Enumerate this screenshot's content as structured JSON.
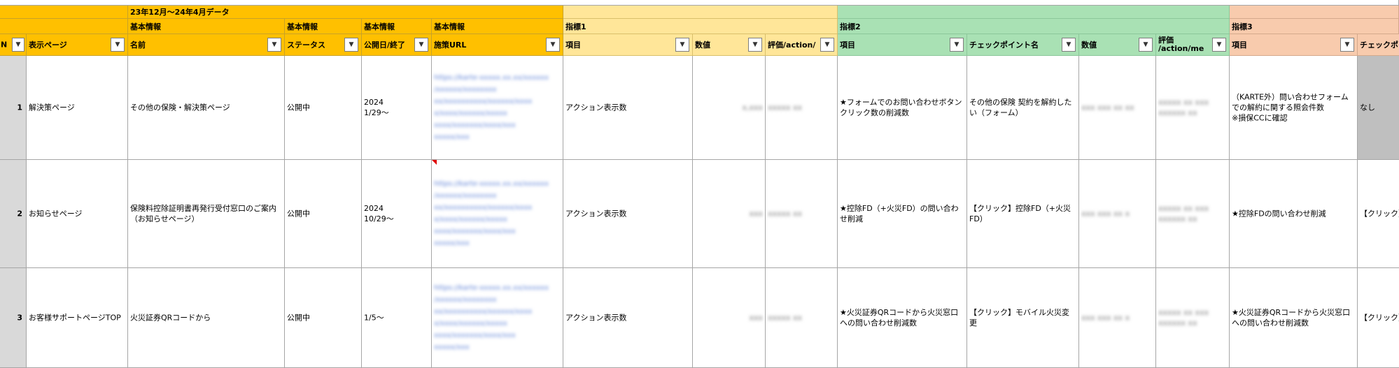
{
  "period_label": "23年12月～24年4月データ",
  "group_headers": {
    "basic": "基本情報",
    "indicator1": "指標1",
    "indicator2": "指標2",
    "indicator3": "指標3"
  },
  "columns": {
    "no": "N",
    "display_page": "表示ページ",
    "name": "名前",
    "status": "ステータス",
    "publish_date": "公開日/終了",
    "url": "施策URL",
    "i1_item": "項目",
    "i1_value": "数値",
    "i1_eval": "評価/action/",
    "i2_item": "項目",
    "i2_checkpoint": "チェックポイント名",
    "i2_value": "数値",
    "i2_eval": "評価\n/action/me",
    "i3_item": "項目",
    "i3_checkpoint": "チェックポイ"
  },
  "filter_icon": "dropdown-triangle",
  "rows": [
    {
      "num": "1",
      "display_page": "解決策ページ",
      "name": "その他の保険・解決策ページ",
      "status": "公開中",
      "publish_date": "2024\n1/29～",
      "url_blurred": "https://karte-xxxxx.xx.xx/xxxxxx\n/xxxxxx/xxxxxxxx\nxx/xxxxxxxxxx/xxxxxx/xxxx\nx/xxxx/xxxxxx/xxxxx\nxxxx/xxxxxxx/xxxx/xxx\nxxxxx/xxx",
      "i1_item": "アクション表示数",
      "i1_value_blurred": "x,xxx",
      "i1_eval_blurred": "xxxxx xx",
      "i2_item": "★フォームでのお問い合わせボタンクリック数の削減数",
      "i2_checkpoint": "その他の保険 契約を解約したい（フォーム）",
      "i2_value_blurred": "xxx xxx xx xx",
      "i2_eval_blurred": "xxxxx xx xxx\nxxxxxx xx",
      "i3_item": "（KARTE外）問い合わせフォームでの解約に関する照会件数\n※損保CCに確認",
      "i3_checkpoint": "なし"
    },
    {
      "num": "2",
      "display_page": "お知らせページ",
      "name": "保険料控除証明書再発行受付窓口のご案内（お知らせページ）",
      "status": "公開中",
      "publish_date": "2024\n10/29～",
      "url_blurred": "https://karte-xxxxx.xx.xx/xxxxxx\n/xxxxxx/xxxxxxxx\nxx/xxxxxxxxxx/xxxxxx/xxxx\nx/xxxx/xxxxxx/xxxxx\nxxxx/xxxxxxx/xxxx/xxx\nxxxxx/xxx",
      "i1_item": "アクション表示数",
      "i1_value_blurred": "xxx",
      "i1_eval_blurred": "xxxxx xx",
      "i2_item": "★控除FD（+火災FD）の問い合わせ削減",
      "i2_checkpoint": "【クリック】控除FD（+火災FD）",
      "i2_value_blurred": "xxx xxx xx x",
      "i2_eval_blurred": "xxxxx xx xxx\nxxxxxx xx",
      "i3_item": "★控除FDの問い合わせ削減",
      "i3_checkpoint": "【クリック】控"
    },
    {
      "num": "3",
      "display_page": "お客様サポートページTOP",
      "name": "火災証券QRコードから",
      "status": "公開中",
      "publish_date": "1/5～",
      "url_blurred": "https://karte-xxxxx.xx.xx/xxxxxx\n/xxxxxx/xxxxxxxx\nxx/xxxxxxxxxx/xxxxxx/xxxx\nx/xxxx/xxxxxx/xxxxx\nxxxx/xxxxxxx/xxxx/xxx\nxxxxx/xxx",
      "i1_item": "アクション表示数",
      "i1_value_blurred": "xxx",
      "i1_eval_blurred": "xxxxx xx",
      "i2_item": "★火災証券QRコードから火災窓口への問い合わせ削減数",
      "i2_checkpoint": "【クリック】モバイル火災変更",
      "i2_value_blurred": "xxx xxx xx x",
      "i2_eval_blurred": "xxxxx xx xxx\nxxxxxx xx",
      "i3_item": "★火災証券QRコードから火災窓口への問い合わせ削減数",
      "i3_checkpoint": "【クリック】モバ"
    }
  ],
  "colors": {
    "gold": "#ffc000",
    "indicator1": "#ffe699",
    "indicator2": "#a9e1b4",
    "indicator3": "#f8cbad",
    "row_header": "#d9d9d9"
  }
}
